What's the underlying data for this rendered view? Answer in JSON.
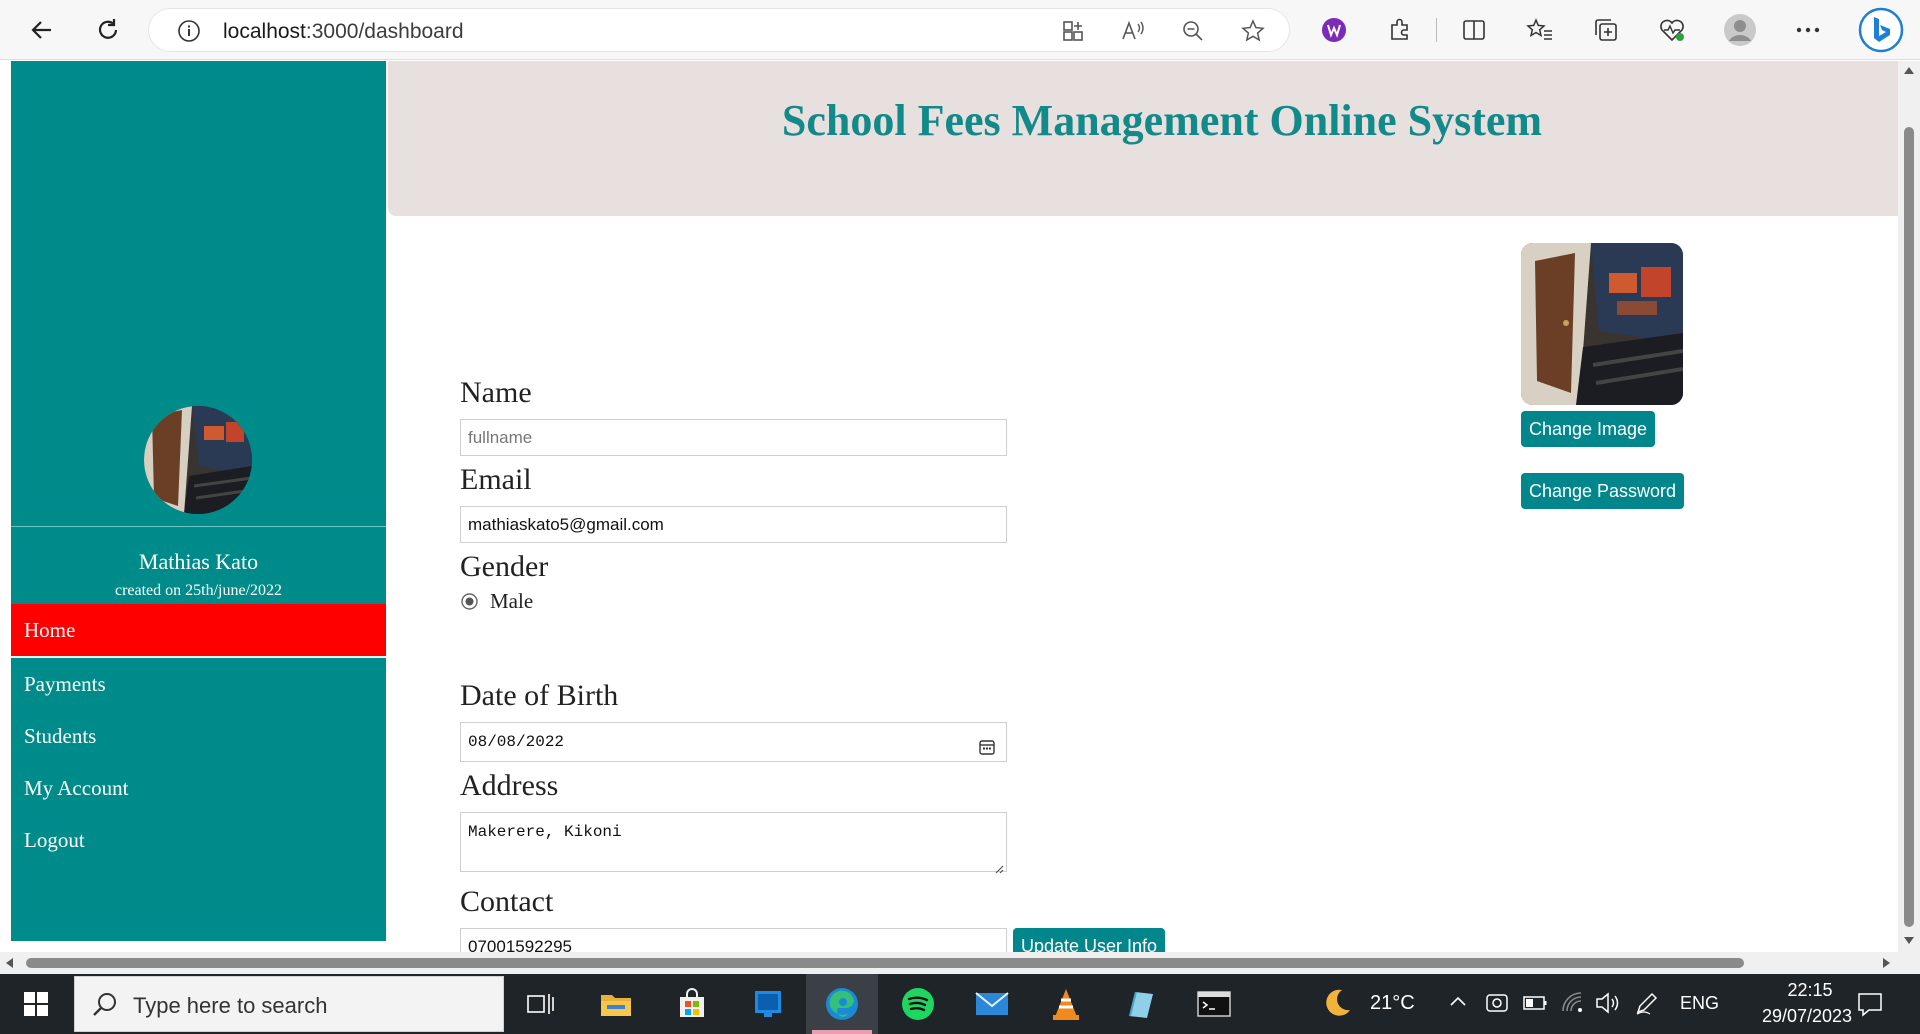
{
  "browser": {
    "url_host": "localhost",
    "url_path": ":3000/dashboard"
  },
  "sidebar": {
    "user_name": "Mathias Kato",
    "created": "created on 25th/june/2022",
    "items": [
      {
        "label": "Home",
        "active": true
      },
      {
        "label": "Payments",
        "active": false
      },
      {
        "label": "Students",
        "active": false
      },
      {
        "label": "My Account",
        "active": false
      },
      {
        "label": "Logout",
        "active": false
      }
    ]
  },
  "header": {
    "title": "School Fees Management Online System"
  },
  "form": {
    "name_label": "Name",
    "name_placeholder": "fullname",
    "email_label": "Email",
    "email_value": "mathiaskato5@gmail.com",
    "gender_label": "Gender",
    "gender_option": "Male",
    "dob_label": "Date of Birth",
    "dob_value": "08/08/2022",
    "address_label": "Address",
    "address_value": "Makerere, Kikoni",
    "contact_label": "Contact",
    "contact_value": "07001592295",
    "update_button": "Update User Info"
  },
  "profile": {
    "change_image_button": "Change Image",
    "change_password_button": "Change Password"
  },
  "taskbar": {
    "search_placeholder": "Type here to search",
    "temperature": "21°C",
    "language": "ENG",
    "time": "22:15",
    "date": "29/07/2023"
  },
  "colors": {
    "sidebar": "#008b8b",
    "active_nav": "#ff0000",
    "header_bg": "#e8dfdf",
    "title": "#138a8a",
    "button": "#00868b"
  }
}
